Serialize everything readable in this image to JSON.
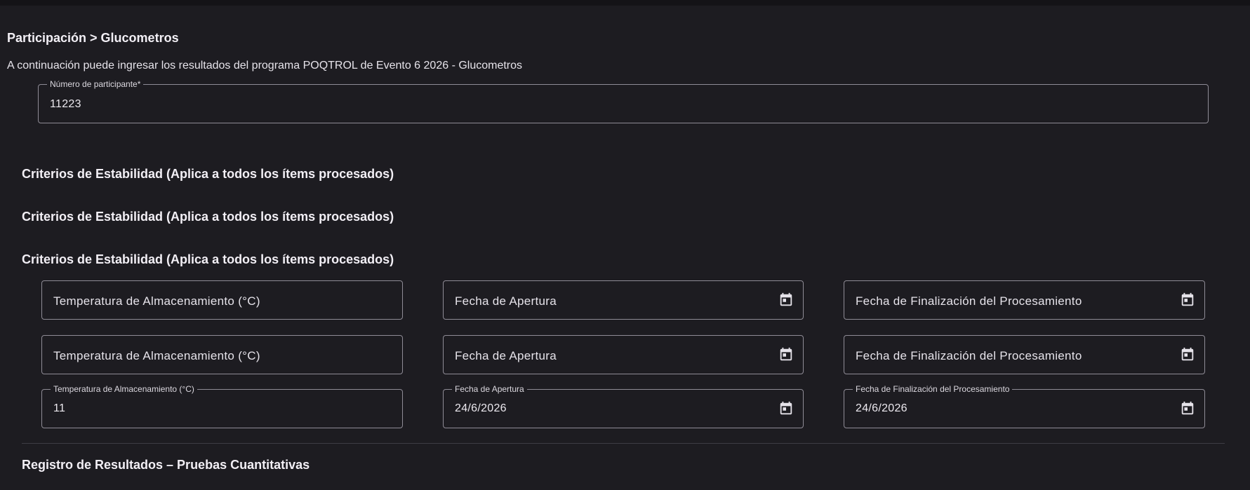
{
  "breadcrumb": "Participación > Glucometros",
  "intro": "A continuación puede ingresar los resultados del programa POQTROL de Evento 6 2026 - Glucometros",
  "participant": {
    "label": "Número de participante*",
    "value": "11223"
  },
  "stability_titles": [
    "Criterios de Estabilidad (Aplica a todos los ítems procesados)",
    "Criterios de Estabilidad (Aplica a todos los ítems procesados)",
    "Criterios de Estabilidad (Aplica a todos los ítems procesados)"
  ],
  "rows": [
    {
      "temperature": {
        "label": "Temperatura de Almacenamiento (°C)",
        "value": ""
      },
      "opening": {
        "label": "Fecha de Apertura",
        "value": ""
      },
      "end": {
        "label": "Fecha de Finalización del Procesamiento",
        "value": ""
      }
    },
    {
      "temperature": {
        "label": "Temperatura de Almacenamiento (°C)",
        "value": ""
      },
      "opening": {
        "label": "Fecha de Apertura",
        "value": ""
      },
      "end": {
        "label": "Fecha de Finalización del Procesamiento",
        "value": ""
      }
    },
    {
      "temperature": {
        "label": "Temperatura de Almacenamiento (°C)",
        "value": "11"
      },
      "opening": {
        "label": "Fecha de Apertura",
        "value": "24/6/2026"
      },
      "end": {
        "label": "Fecha de Finalización del Procesamiento",
        "value": "24/6/2026"
      }
    }
  ],
  "results_title": "Registro de Resultados – Pruebas Cuantitativas",
  "icons": {
    "date": "calendar-icon"
  }
}
